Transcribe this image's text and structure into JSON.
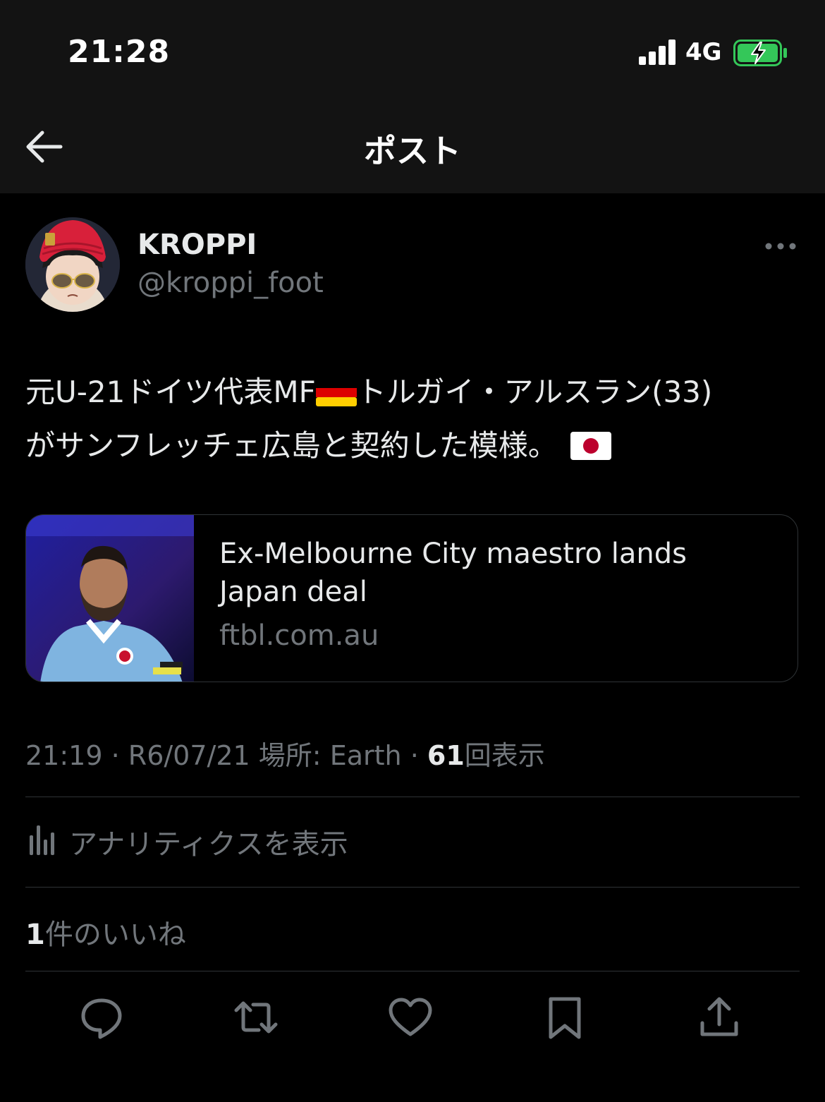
{
  "status_bar": {
    "time": "21:28",
    "network": "4G"
  },
  "nav": {
    "title": "ポスト"
  },
  "author": {
    "display_name": "KROPPI",
    "handle": "@kroppi_foot"
  },
  "tweet": {
    "text_part1": "元U-21ドイツ代表MF",
    "text_part2": "トルガイ・アルスラン(33)",
    "text_part3": "がサンフレッチェ広島と契約した模様。"
  },
  "link_card": {
    "title": "Ex-Melbourne City maestro lands Japan deal",
    "domain": "ftbl.com.au"
  },
  "meta": {
    "time": "21:19",
    "separator": "·",
    "date": "R6/07/21",
    "location_label": "場所:",
    "location": "Earth",
    "views_count": "61",
    "views_label": "回表示"
  },
  "analytics": {
    "label": "アナリティクスを表示"
  },
  "likes": {
    "count": "1",
    "label": "件のいいね"
  },
  "colors": {
    "background": "#000000",
    "bar_background": "#131313",
    "text_primary": "#e7e9ea",
    "text_secondary": "#71767b",
    "divider": "#2f3336",
    "battery_green": "#34c759"
  },
  "icons": {
    "back": "arrow-left-icon",
    "more": "more-horizontal-icon",
    "analytics": "bar-chart-icon",
    "reply": "reply-icon",
    "retweet": "retweet-icon",
    "like": "heart-icon",
    "bookmark": "bookmark-icon",
    "share": "share-icon"
  }
}
